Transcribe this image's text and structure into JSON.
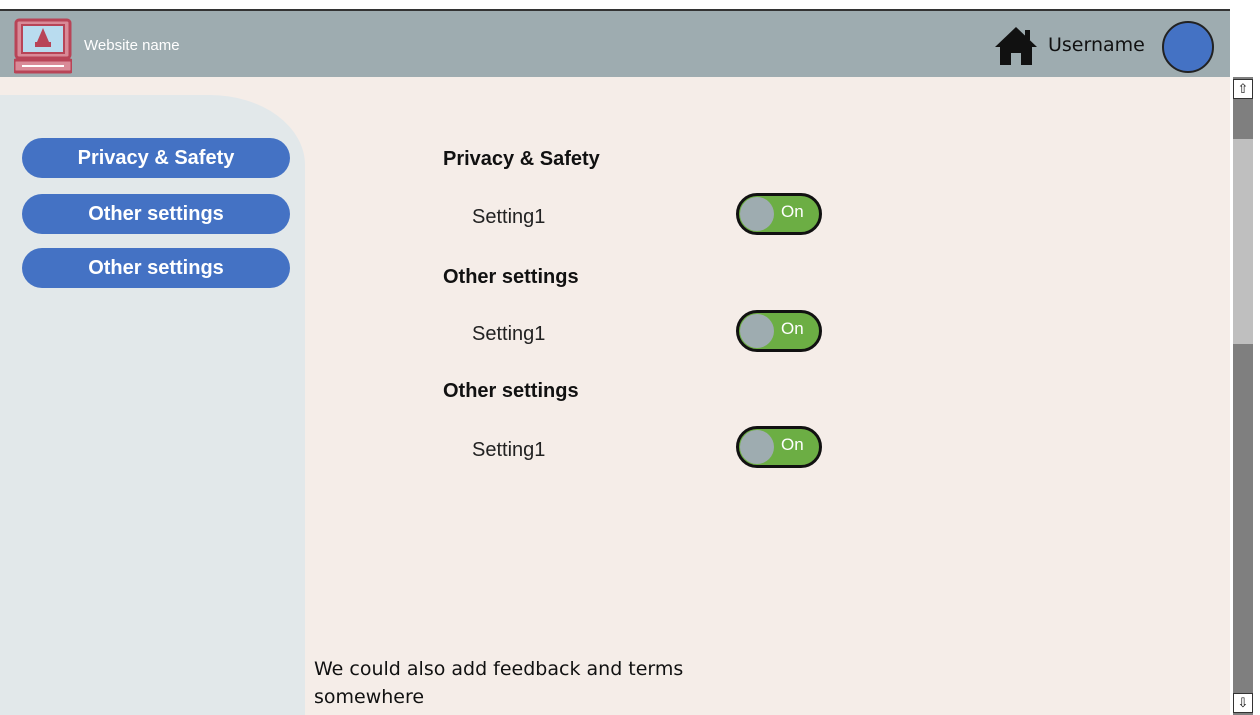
{
  "header": {
    "site_name": "Website name",
    "username": "Username",
    "icons": {
      "logo": "laptop-icon",
      "home": "home-icon",
      "avatar": "avatar"
    }
  },
  "sidebar": {
    "items": [
      {
        "label": "Privacy & Safety"
      },
      {
        "label": "Other settings"
      },
      {
        "label": "Other settings"
      }
    ]
  },
  "sections": [
    {
      "title": "Privacy & Safety",
      "setting_label": "Setting1",
      "toggle_label": "On",
      "toggle_on": true
    },
    {
      "title": "Other settings",
      "setting_label": "Setting1",
      "toggle_label": "On",
      "toggle_on": true
    },
    {
      "title": "Other settings",
      "setting_label": "Setting1",
      "toggle_label": "On",
      "toggle_on": true
    }
  ],
  "footer": {
    "note": "We could also add feedback and terms somewhere"
  },
  "scrollbar": {
    "up_glyph": "⇧",
    "down_glyph": "⇩"
  },
  "colors": {
    "header_bg": "#9eacb0",
    "accent": "#4472c4",
    "toggle_on": "#6cae44",
    "main_bg": "#f5ede8",
    "sidebar_bg": "#e2e8ea"
  }
}
